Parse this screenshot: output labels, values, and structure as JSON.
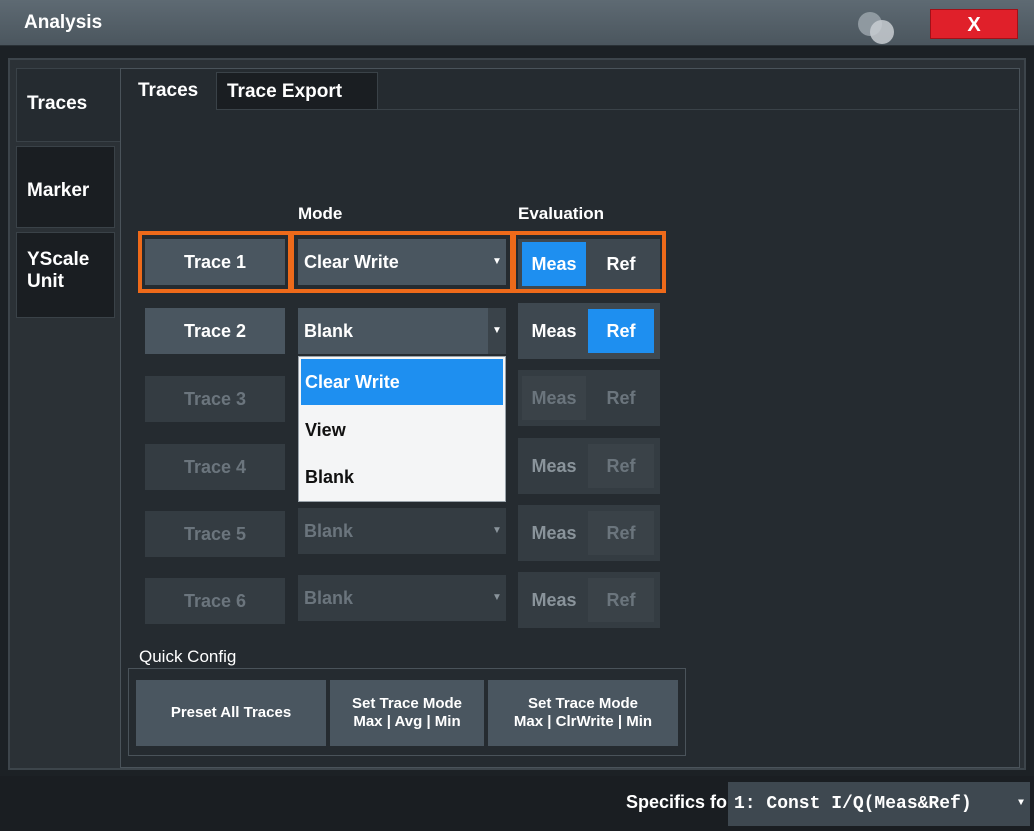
{
  "window": {
    "title": "Analysis",
    "close_label": "X"
  },
  "side_tabs": [
    {
      "label": "Traces",
      "active": true
    },
    {
      "label": "Marker",
      "active": false
    },
    {
      "label": "YScale\nUnit",
      "active": false
    }
  ],
  "top_tabs": [
    {
      "label": "Traces",
      "active": true
    },
    {
      "label": "Trace Export",
      "active": false
    }
  ],
  "columns": {
    "mode": "Mode",
    "evaluation": "Evaluation"
  },
  "traces": [
    {
      "label": "Trace 1",
      "mode": "Clear Write",
      "meas": "Meas",
      "ref": "Ref",
      "selected": "Meas",
      "enabled": true
    },
    {
      "label": "Trace 2",
      "mode": "Blank",
      "meas": "Meas",
      "ref": "Ref",
      "selected": "Ref",
      "enabled": true
    },
    {
      "label": "Trace 3",
      "mode": "",
      "meas": "Meas",
      "ref": "Ref",
      "selected": "",
      "enabled": false
    },
    {
      "label": "Trace 4",
      "mode": "",
      "meas": "Meas",
      "ref": "Ref",
      "selected": "",
      "enabled": false
    },
    {
      "label": "Trace 5",
      "mode": "Blank",
      "meas": "Meas",
      "ref": "Ref",
      "selected": "",
      "enabled": false
    },
    {
      "label": "Trace 6",
      "mode": "Blank",
      "meas": "Meas",
      "ref": "Ref",
      "selected": "",
      "enabled": false
    }
  ],
  "mode_dropdown": {
    "options": [
      "Clear Write",
      "View",
      "Blank"
    ],
    "highlighted": "Clear Write"
  },
  "quick_config": {
    "label": "Quick Config",
    "preset": "Preset All Traces",
    "mode_avg": [
      "Set Trace Mode",
      "Max | Avg | Min"
    ],
    "mode_clrwrite": [
      "Set Trace Mode",
      "Max | ClrWrite | Min"
    ]
  },
  "specifics": {
    "label": "Specifics for",
    "value": "1: Const I/Q(Meas&Ref)"
  },
  "colors": {
    "accent": "#1e8ff0",
    "highlight": "#ee6a1a",
    "close": "#e0202a"
  }
}
